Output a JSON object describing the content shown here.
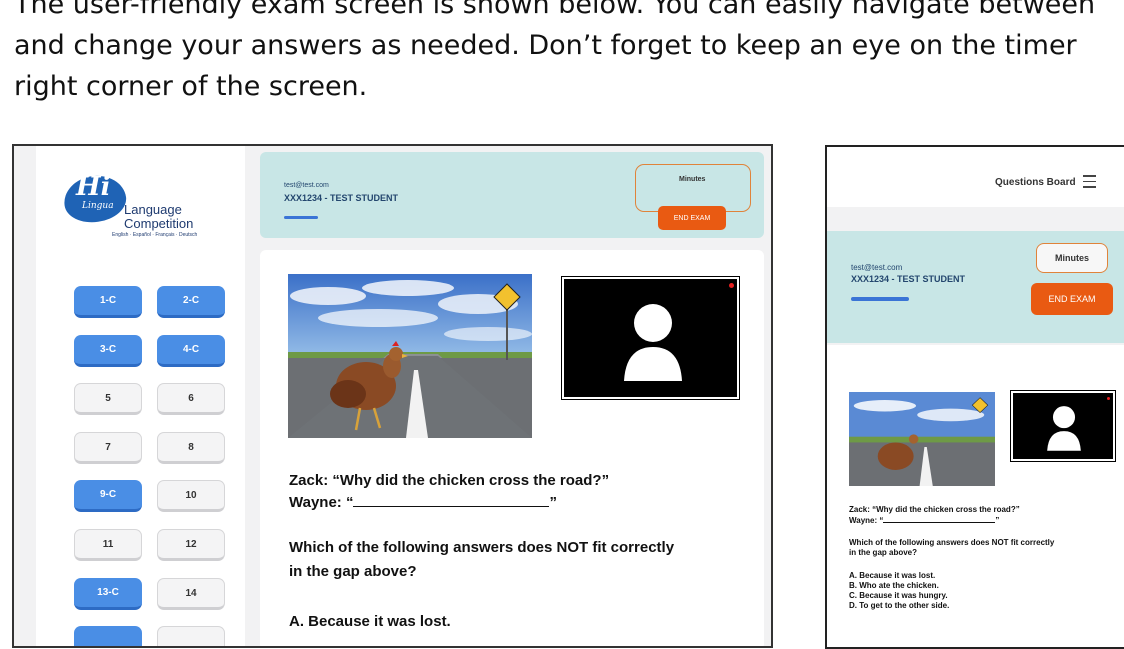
{
  "intro": {
    "line1": "The user-friendly exam screen is shown below. You can easily navigate between",
    "line2": "and change your answers as needed. Don’t forget to keep an eye on the timer",
    "line3": "right corner of the screen."
  },
  "logo": {
    "mark": "Hi",
    "sub": "Lingua",
    "line1": "Language",
    "line2": "Competition",
    "tagline": "English · Español · Français · Deutsch"
  },
  "questions": [
    {
      "label": "1-C",
      "answered": true
    },
    {
      "label": "2-C",
      "answered": true
    },
    {
      "label": "3-C",
      "answered": true
    },
    {
      "label": "4-C",
      "answered": true
    },
    {
      "label": "5",
      "answered": false
    },
    {
      "label": "6",
      "answered": false
    },
    {
      "label": "7",
      "answered": false
    },
    {
      "label": "8",
      "answered": false
    },
    {
      "label": "9-C",
      "answered": true
    },
    {
      "label": "10",
      "answered": false
    },
    {
      "label": "11",
      "answered": false
    },
    {
      "label": "12",
      "answered": false
    },
    {
      "label": "13-C",
      "answered": true
    },
    {
      "label": "14",
      "answered": false
    },
    {
      "label": "",
      "answered": true
    },
    {
      "label": "",
      "answered": false
    }
  ],
  "header": {
    "email": "test@test.com",
    "student": "XXX1234 - TEST STUDENT",
    "timer_label": "Minutes",
    "end_exam": "END EXAM"
  },
  "camera": {
    "rec": "REC"
  },
  "question": {
    "zack": "Zack: “Why did the chicken cross the road?”",
    "wayne_open": "Wayne: “",
    "wayne_close": "”",
    "prompt_line1": "Which of the following answers does NOT fit correctly",
    "prompt_line2": "in the gap above?",
    "options": [
      "A. Because it was lost.",
      "B. Who ate the chicken.",
      "C. Because it was hungry.",
      "D. To get to the other side."
    ]
  },
  "mobile": {
    "questions_board": "Questions Board",
    "prompt_line1": "Which of the following answers does NOT fit correctly",
    "prompt_line2": "in the gap above?"
  },
  "colors": {
    "answered": "#4a8ee5",
    "end_exam": "#e95a12",
    "header_bg": "#c8e6e6",
    "timer_border": "#e0833a"
  }
}
